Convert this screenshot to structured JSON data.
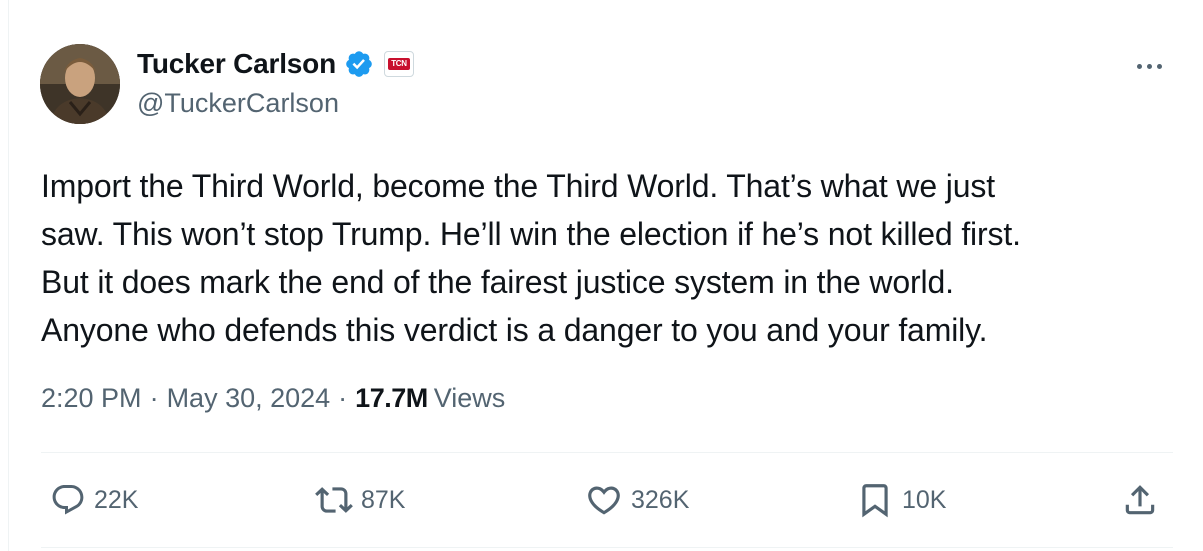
{
  "author": {
    "display_name": "Tucker Carlson",
    "handle": "@TuckerCarlson",
    "affiliate_badge": "TCN",
    "verified_color": "#1d9bf0"
  },
  "tweet": {
    "lines": [
      "Import the Third World, become the Third World. That’s what we just",
      "saw. This won’t stop Trump. He’ll win the election if he’s not killed first.",
      "But it does mark the end of the fairest justice system in the world.",
      "Anyone who defends this verdict is a danger to you and your family."
    ]
  },
  "meta": {
    "time": "2:20 PM",
    "separator": "·",
    "date": "May 30, 2024",
    "views_count": "17.7M",
    "views_label": "Views"
  },
  "actions": {
    "replies": "22K",
    "reposts": "87K",
    "likes": "326K",
    "bookmarks": "10K"
  },
  "icons": {
    "verified": "verified-badge-icon",
    "more": "more-options-icon",
    "reply": "reply-icon",
    "repost": "repost-icon",
    "like": "heart-icon",
    "bookmark": "bookmark-icon",
    "share": "share-icon"
  },
  "colors": {
    "text_primary": "#0f1419",
    "text_secondary": "#536471",
    "accent": "#1d9bf0",
    "affiliate_red": "#c8102e"
  }
}
